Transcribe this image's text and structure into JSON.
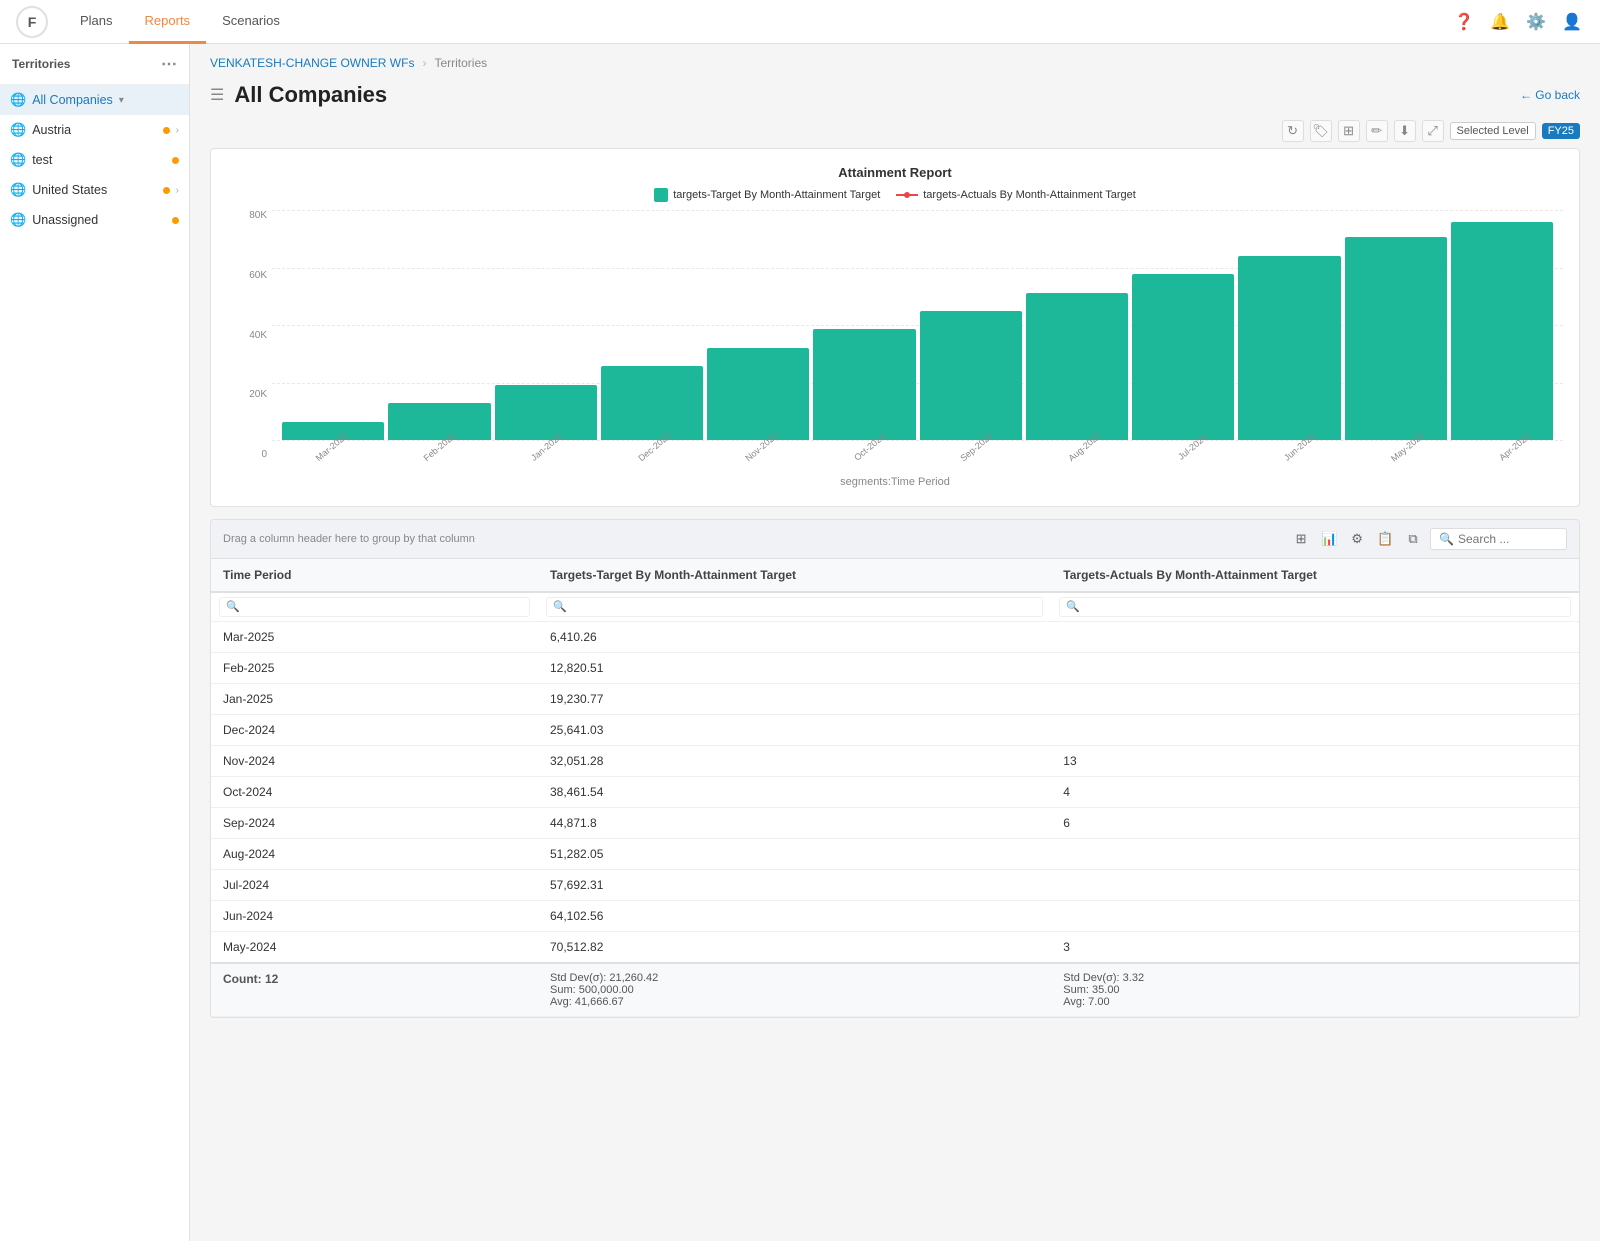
{
  "nav": {
    "logo": "F",
    "items": [
      {
        "label": "Plans",
        "active": false
      },
      {
        "label": "Reports",
        "active": true
      },
      {
        "label": "Scenarios",
        "active": false
      }
    ]
  },
  "sidebar": {
    "header": "Territories",
    "items": [
      {
        "label": "All Companies",
        "type": "all",
        "dot": "orange",
        "active": true
      },
      {
        "label": "Austria",
        "type": "globe",
        "dot": "orange",
        "hasChevron": true
      },
      {
        "label": "test",
        "type": "globe",
        "dot": "orange",
        "hasChevron": false
      },
      {
        "label": "United States",
        "type": "globe",
        "dot": "orange",
        "hasChevron": true
      },
      {
        "label": "Unassigned",
        "type": "globe",
        "dot": "orange",
        "hasChevron": false
      }
    ]
  },
  "breadcrumb": {
    "parent": "VENKATESH-CHANGE OWNER WFs",
    "current": "Territories"
  },
  "page": {
    "title": "All Companies",
    "go_back": "← Go back"
  },
  "chart": {
    "title": "Attainment Report",
    "legend": [
      {
        "label": "targets-Target By Month-Attainment Target",
        "type": "bar",
        "color": "#1db89a"
      },
      {
        "label": "targets-Actuals By Month-Attainment Target",
        "type": "line",
        "color": "#e44"
      }
    ],
    "selected_level": "Selected Level",
    "fy_badge": "FY25",
    "x_axis_title": "segments:Time Period",
    "y_labels": [
      "80K",
      "60K",
      "40K",
      "20K",
      "0"
    ],
    "bars": [
      {
        "label": "Mar-2025",
        "value": 6410,
        "max": 80000
      },
      {
        "label": "Feb-2025",
        "value": 12820,
        "max": 80000
      },
      {
        "label": "Jan-2025",
        "value": 19230,
        "max": 80000
      },
      {
        "label": "Dec-2024",
        "value": 25641,
        "max": 80000
      },
      {
        "label": "Nov-2024",
        "value": 32051,
        "max": 80000
      },
      {
        "label": "Oct-2024",
        "value": 38461,
        "max": 80000
      },
      {
        "label": "Sep-2024",
        "value": 44871,
        "max": 80000
      },
      {
        "label": "Aug-2024",
        "value": 51282,
        "max": 80000
      },
      {
        "label": "Jul-2024",
        "value": 57692,
        "max": 80000
      },
      {
        "label": "Jun-2024",
        "value": 64102,
        "max": 80000
      },
      {
        "label": "May-2024",
        "value": 70512,
        "max": 80000
      },
      {
        "label": "Apr-2024",
        "value": 76000,
        "max": 80000
      }
    ]
  },
  "table": {
    "drag_hint": "Drag a column header here to group by that column",
    "search_placeholder": "Search ...",
    "columns": [
      {
        "label": "Time Period"
      },
      {
        "label": "Targets-Target By Month-Attainment Target"
      },
      {
        "label": "Targets-Actuals By Month-Attainment Target"
      }
    ],
    "rows": [
      {
        "period": "Mar-2025",
        "target": "6,410.26",
        "actuals": ""
      },
      {
        "period": "Feb-2025",
        "target": "12,820.51",
        "actuals": ""
      },
      {
        "period": "Jan-2025",
        "target": "19,230.77",
        "actuals": ""
      },
      {
        "period": "Dec-2024",
        "target": "25,641.03",
        "actuals": ""
      },
      {
        "period": "Nov-2024",
        "target": "32,051.28",
        "actuals": "13"
      },
      {
        "period": "Oct-2024",
        "target": "38,461.54",
        "actuals": "4"
      },
      {
        "period": "Sep-2024",
        "target": "44,871.8",
        "actuals": "6"
      },
      {
        "period": "Aug-2024",
        "target": "51,282.05",
        "actuals": ""
      },
      {
        "period": "Jul-2024",
        "target": "57,692.31",
        "actuals": ""
      },
      {
        "period": "Jun-2024",
        "target": "64,102.56",
        "actuals": ""
      },
      {
        "period": "May-2024",
        "target": "70,512.82",
        "actuals": "3"
      }
    ],
    "footer": {
      "count": "Count: 12",
      "target_std": "Std Dev(σ): 21,260.42",
      "target_sum": "Sum: 500,000.00",
      "target_avg": "Avg: 41,666.67",
      "actuals_std": "Std Dev(σ): 3.32",
      "actuals_sum": "Sum: 35.00",
      "actuals_avg": "Avg: 7.00"
    }
  }
}
